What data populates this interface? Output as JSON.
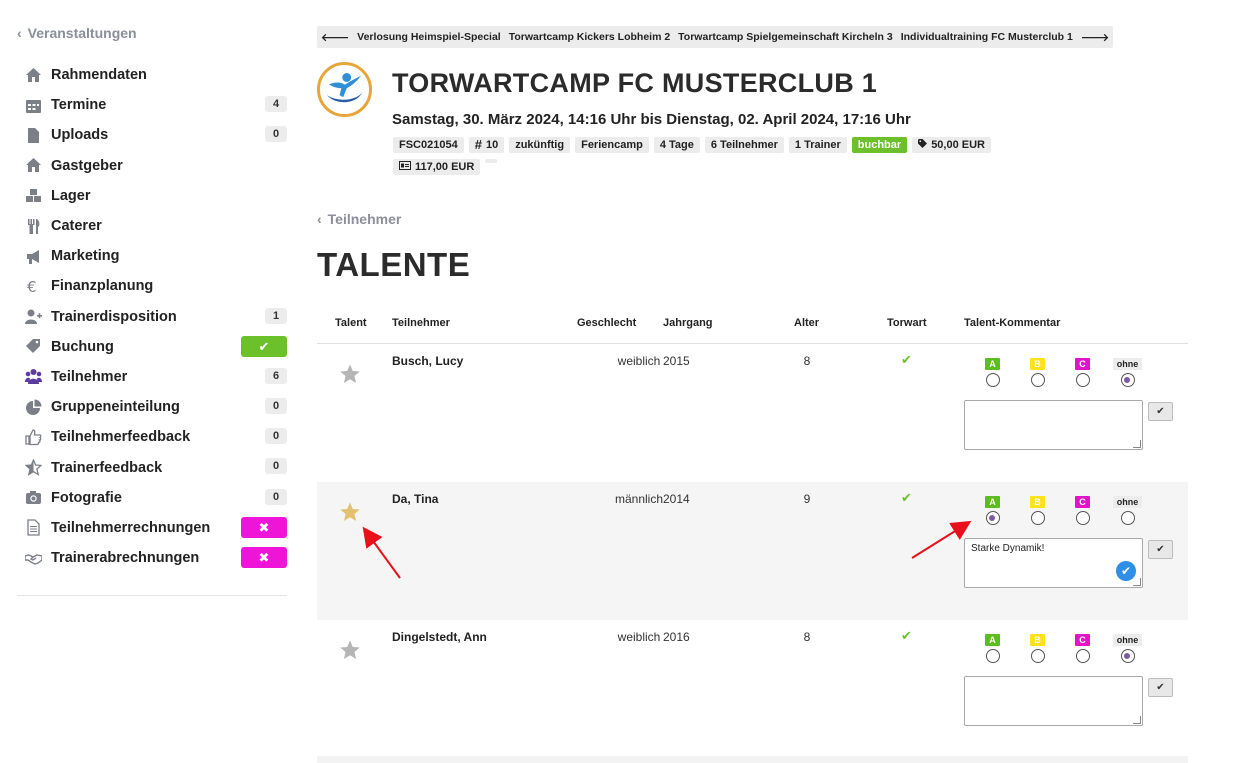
{
  "sidebar": {
    "back_label": "Veranstaltungen",
    "items": [
      {
        "label": "Rahmendaten",
        "icon": "home-icon",
        "badge": null
      },
      {
        "label": "Termine",
        "icon": "calendar-icon",
        "badge": "4"
      },
      {
        "label": "Uploads",
        "icon": "file-icon",
        "badge": "0"
      },
      {
        "label": "Gastgeber",
        "icon": "home-icon",
        "badge": null
      },
      {
        "label": "Lager",
        "icon": "boxes-icon",
        "badge": null
      },
      {
        "label": "Caterer",
        "icon": "cutlery-icon",
        "badge": null
      },
      {
        "label": "Marketing",
        "icon": "megaphone-icon",
        "badge": null
      },
      {
        "label": "Finanzplanung",
        "icon": "euro-icon",
        "badge": null
      },
      {
        "label": "Trainerdisposition",
        "icon": "user-plus-icon",
        "badge": "1"
      },
      {
        "label": "Buchung",
        "icon": "tag-icon",
        "badge": "✔"
      },
      {
        "label": "Teilnehmer",
        "icon": "users-icon",
        "badge": "6"
      },
      {
        "label": "Gruppeneinteilung",
        "icon": "pie-chart-icon",
        "badge": "0"
      },
      {
        "label": "Teilnehmerfeedback",
        "icon": "thumbs-up-icon",
        "badge": "0"
      },
      {
        "label": "Trainerfeedback",
        "icon": "star-half-icon",
        "badge": "0"
      },
      {
        "label": "Fotografie",
        "icon": "camera-icon",
        "badge": "0"
      },
      {
        "label": "Teilnehmerrechnungen",
        "icon": "document-icon",
        "badge": "✖"
      },
      {
        "label": "Trainerabrechnungen",
        "icon": "handshake-icon",
        "badge": "✖"
      }
    ]
  },
  "breadcrumb": {
    "prev_arrow": "🡐",
    "items": [
      "Verlosung Heimspiel-Special",
      "Torwartcamp Kickers Lobheim 2",
      "Torwartcamp Spielgemeinschaft Kircheln 3",
      "Individualtraining FC Musterclub 1"
    ],
    "next_arrow": "🡒"
  },
  "event": {
    "title": "TORWARTCAMP FC MUSTERCLUB 1",
    "date_range": "Samstag, 30. März 2024, 14:16 Uhr bis Dienstag, 02. April 2024, 17:16 Uhr",
    "tags": [
      "FSC021054",
      "10",
      "zukünftig",
      "Feriencamp",
      "4 Tage",
      "6 Teilnehmer",
      "1 Trainer",
      "buchbar",
      "50,00 EUR",
      "117,00 EUR",
      ""
    ]
  },
  "back_participants": "Teilnehmer",
  "page_heading": "TALENTE",
  "table": {
    "headers": [
      "Talent",
      "Teilnehmer",
      "Geschlecht",
      "Jahrgang",
      "Alter",
      "Torwart",
      "Talent-Kommentar"
    ],
    "grade_labels": [
      "A",
      "B",
      "C",
      "ohne"
    ],
    "save_icon": "✔",
    "rows": [
      {
        "name": "Busch, Lucy",
        "gender": "weiblich",
        "year": "2015",
        "age": "8",
        "goalkeeper": "✔",
        "starred": false,
        "grade": "ohne",
        "comment": ""
      },
      {
        "name": "Da, Tina",
        "gender": "männlich",
        "year": "2014",
        "age": "9",
        "goalkeeper": "✔",
        "starred": true,
        "grade": "A",
        "comment": "Starke Dynamik!"
      },
      {
        "name": "Dingelstedt, Ann",
        "gender": "weiblich",
        "year": "2016",
        "age": "8",
        "goalkeeper": "✔",
        "starred": false,
        "grade": "ohne",
        "comment": ""
      }
    ]
  },
  "colors": {
    "accent_purple": "#5b3b9e",
    "success_green": "#6cc12b",
    "alert_pink": "#ee14d8",
    "star_gold": "#e3c16f",
    "star_grey": "#b5b5b5",
    "annotation_red": "#e8101a"
  }
}
